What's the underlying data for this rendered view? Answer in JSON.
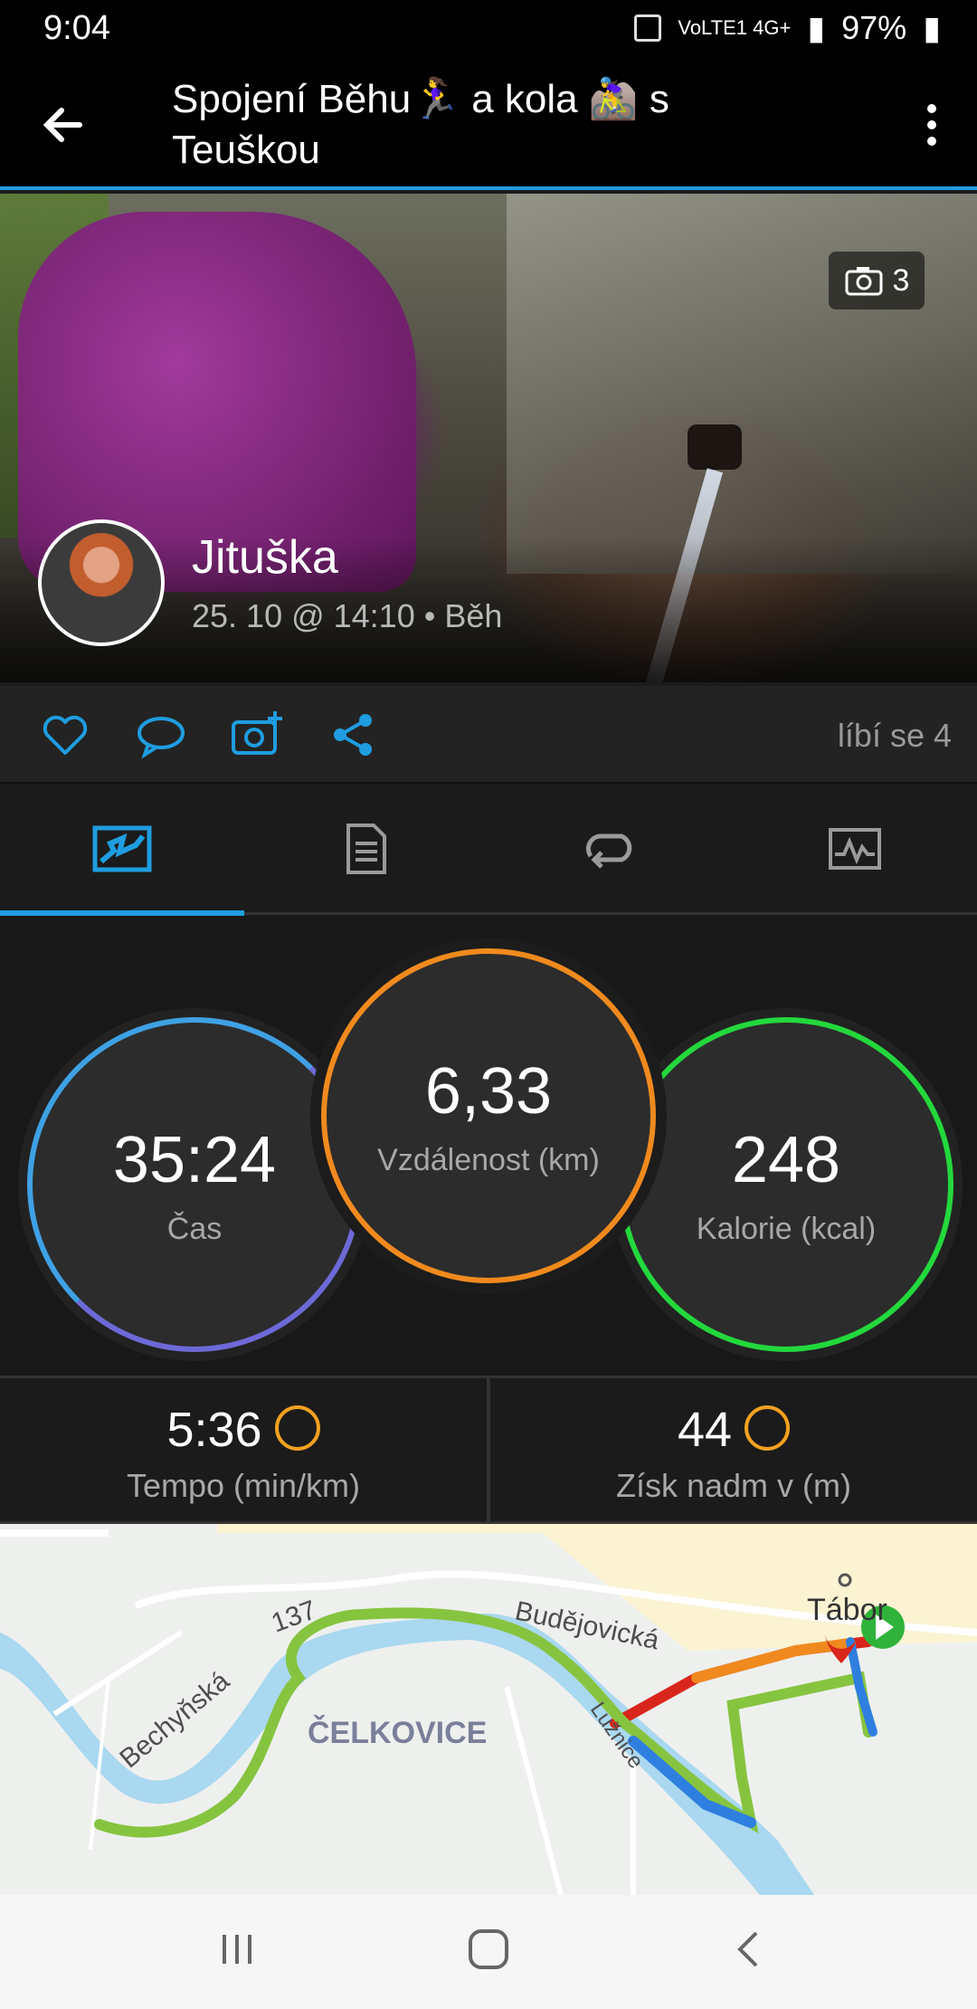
{
  "status_bar": {
    "time": "9:04",
    "network": "VoLTE1 4G+",
    "battery": "97%"
  },
  "app_bar": {
    "title": "Spojení Běhu🏃‍♀️ a kola 🚵‍♀️ s Teuškou"
  },
  "hero": {
    "photo_count": "3",
    "user_name": "Jituška",
    "meta": "25. 10 @ 14:10 • Běh"
  },
  "actions": {
    "likes_label": "líbí se 4"
  },
  "tabs": [
    {
      "icon": "overview-icon",
      "selected": true
    },
    {
      "icon": "details-icon",
      "selected": false
    },
    {
      "icon": "laps-icon",
      "selected": false
    },
    {
      "icon": "chart-icon",
      "selected": false
    }
  ],
  "stats": {
    "time": {
      "value": "35:24",
      "label": "Čas"
    },
    "distance": {
      "value": "6,33",
      "label": "Vzdálenost (km)"
    },
    "calories": {
      "value": "248",
      "label": "Kalorie (kcal)"
    }
  },
  "metrics": {
    "pace": {
      "value": "5:36",
      "label": "Tempo (min/km)"
    },
    "elevation": {
      "value": "44",
      "label": "Získ nadm v (m)"
    }
  },
  "map": {
    "labels": {
      "road_137": "137",
      "budejovicka": "Budějovická",
      "bechynska": "Bechyňská",
      "celkovice": "ČELKOVICE",
      "luznice": "Lužnice",
      "tabor": "Tábor"
    }
  },
  "colors": {
    "accent_blue": "#1f9de0",
    "time_ring": "#4f8ee0",
    "distance_ring": "#f08a1e",
    "calories_ring": "#23d83c",
    "route_green": "#86c440",
    "route_red": "#d9261c"
  }
}
